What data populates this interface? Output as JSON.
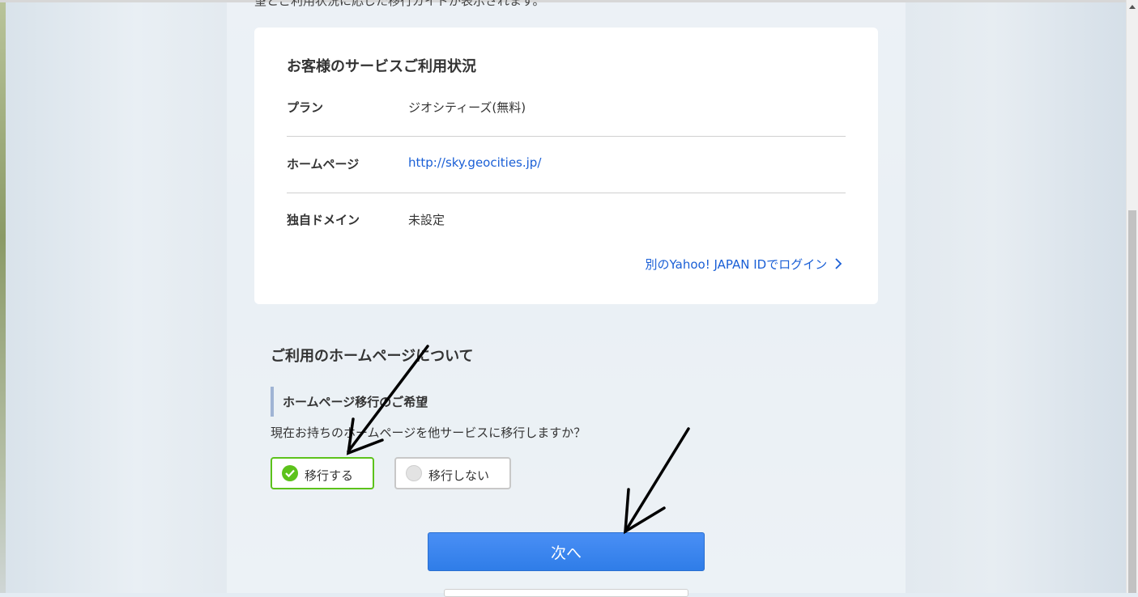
{
  "page": {
    "truncated_intro": "望とご利用状況に応じた移行ガイドが表示されます。"
  },
  "usage_card": {
    "title": "お客様のサービスご利用状況",
    "rows": [
      {
        "label": "プラン",
        "value": "ジオシティーズ(無料)"
      },
      {
        "label": "ホームページ",
        "value": "http://sky.geocities.jp/"
      },
      {
        "label": "独自ドメイン",
        "value": "未設定"
      }
    ],
    "alt_login": "別のYahoo! JAPAN IDでログイン"
  },
  "homepage_section": {
    "title": "ご利用のホームページについて",
    "subheading": "ホームページ移行のご希望",
    "question": "現在お持ちのホームページを他サービスに移行しますか？",
    "options": [
      {
        "label": "移行する",
        "selected": true
      },
      {
        "label": "移行しない",
        "selected": false
      }
    ],
    "next_button": "次へ"
  },
  "colors": {
    "accent_blue": "#2f7de8",
    "link_blue": "#1a5fd6",
    "selected_green": "#5cc21b"
  },
  "icons": [
    "check-icon",
    "chevron-right-icon",
    "scroll-up-arrow-icon",
    "arrow-annotation"
  ]
}
